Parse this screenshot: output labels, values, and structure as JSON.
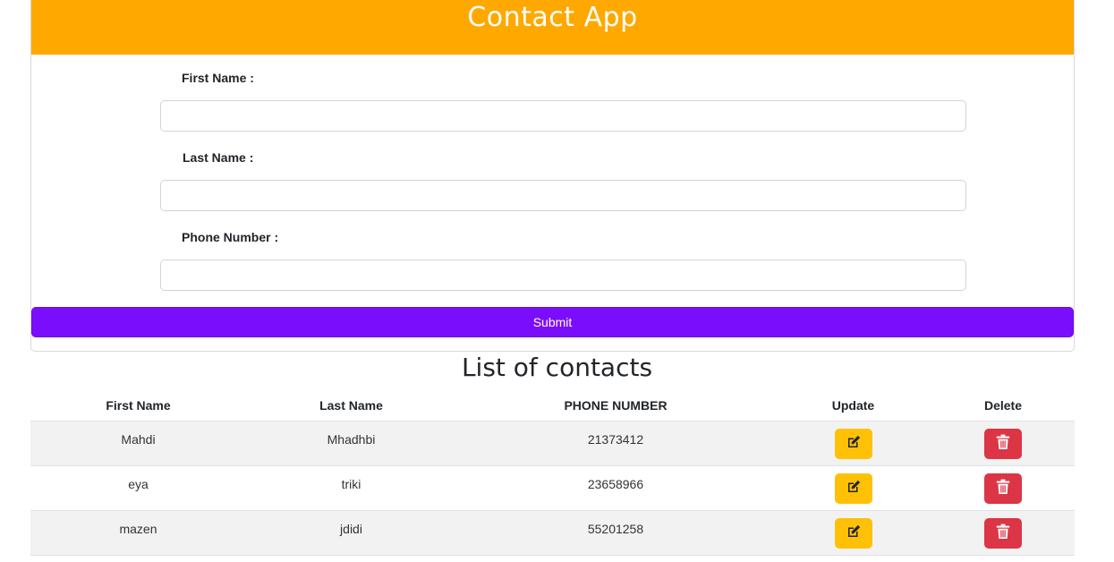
{
  "app": {
    "title": "Contact App",
    "header_color": "#ffa800"
  },
  "form": {
    "first_name_label": "First Name :",
    "first_name_value": "",
    "last_name_label": "Last Name :",
    "last_name_value": "",
    "phone_label": "Phone Number :",
    "phone_value": "",
    "submit_label": "Submit",
    "submit_color": "#7a0efc"
  },
  "contacts": {
    "title": "List of contacts",
    "columns": [
      "First Name",
      "Last Name",
      "PHONE NUMBER",
      "Update",
      "Delete"
    ],
    "rows": [
      {
        "first_name": "Mahdi",
        "last_name": "Mhadhbi",
        "phone": "21373412"
      },
      {
        "first_name": "eya",
        "last_name": "triki",
        "phone": "23658966"
      },
      {
        "first_name": "mazen",
        "last_name": "jdidi",
        "phone": "55201258"
      }
    ],
    "update_icon": "edit-icon",
    "delete_icon": "trash-icon",
    "update_color": "#ffc107",
    "delete_color": "#dc3545"
  }
}
